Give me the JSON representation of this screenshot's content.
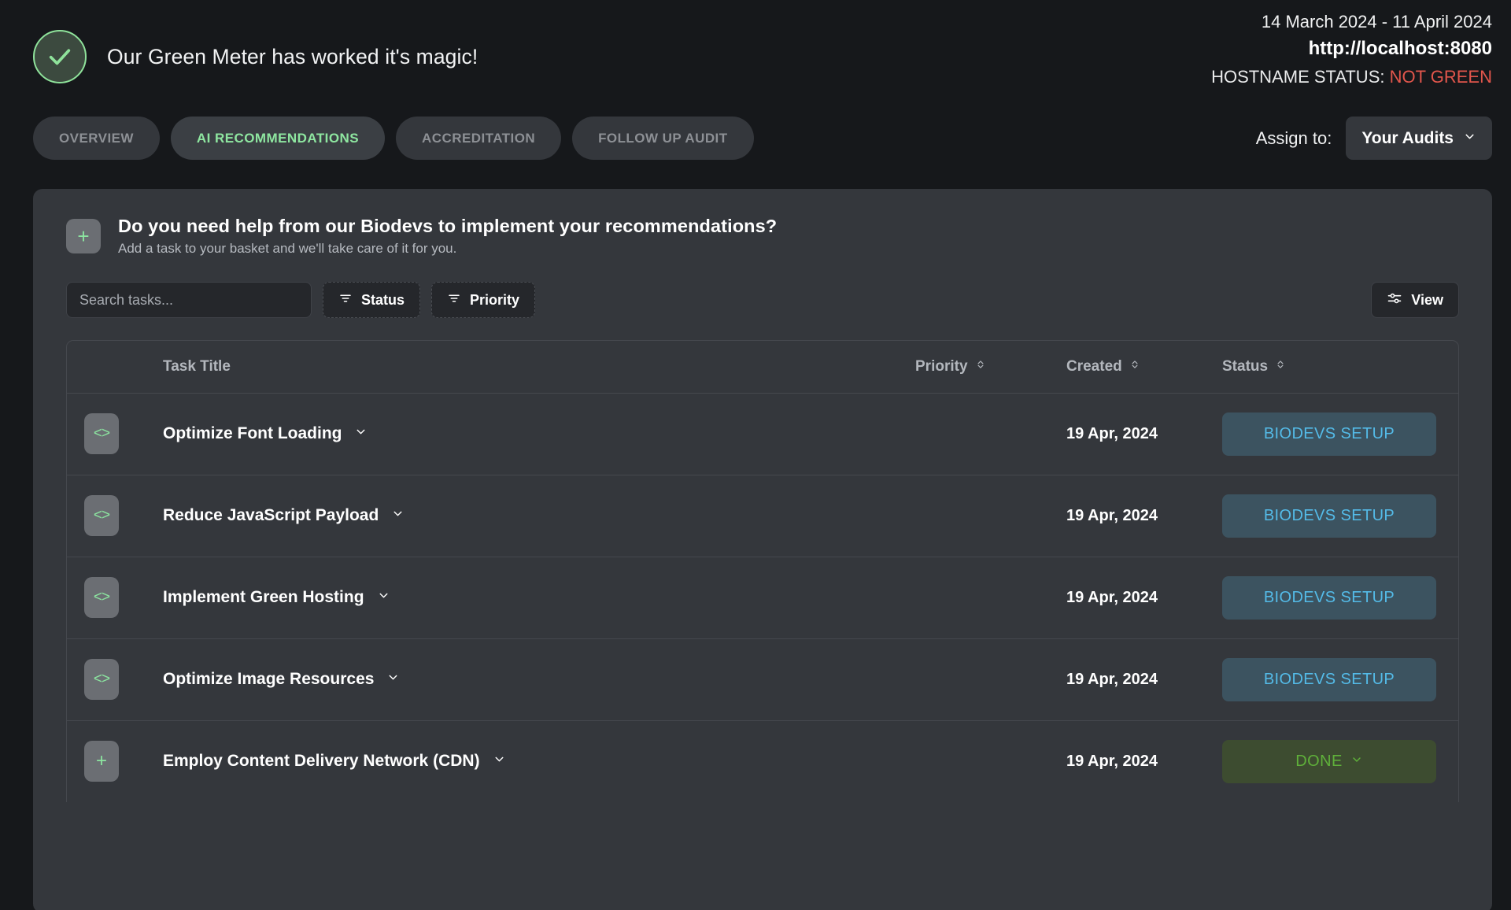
{
  "header": {
    "check_icon": "check-circle-icon",
    "headline": "Our Green Meter has worked it's magic!",
    "date_range": "14 March 2024 - 11 April 2024",
    "url": "http://localhost:8080",
    "hostname_status_label": "HOSTNAME STATUS:",
    "hostname_status_value": "NOT GREEN",
    "status_color": "#e2564c"
  },
  "tabs": [
    {
      "label": "OVERVIEW",
      "active": false
    },
    {
      "label": "AI RECOMMENDATIONS",
      "active": true
    },
    {
      "label": "ACCREDITATION",
      "active": false
    },
    {
      "label": "FOLLOW UP AUDIT",
      "active": false
    }
  ],
  "assign": {
    "label": "Assign to:",
    "selected": "Your Audits",
    "options": [
      "Your Audits"
    ]
  },
  "promo": {
    "badge_icon": "plus-icon",
    "title": "Do you need help from our Biodevs to implement your recommendations?",
    "subtitle": "Add a task to your basket and we'll take care of it for you."
  },
  "toolbar": {
    "search_placeholder": "Search tasks...",
    "search_value": "",
    "status_filter_label": "Status",
    "priority_filter_label": "Priority",
    "view_label": "View"
  },
  "table": {
    "columns": [
      {
        "key": "icon",
        "label": "",
        "sortable": false
      },
      {
        "key": "title",
        "label": "Task Title",
        "sortable": false
      },
      {
        "key": "priority",
        "label": "Priority",
        "sortable": true
      },
      {
        "key": "created",
        "label": "Created",
        "sortable": true
      },
      {
        "key": "status",
        "label": "Status",
        "sortable": true
      }
    ],
    "rows": [
      {
        "badge_icon": "code-icon",
        "title": "Optimize Font Loading",
        "priority": "",
        "created": "19 Apr, 2024",
        "status": "BIODEVS SETUP",
        "status_kind": "setup"
      },
      {
        "badge_icon": "code-icon",
        "title": "Reduce JavaScript Payload",
        "priority": "",
        "created": "19 Apr, 2024",
        "status": "BIODEVS SETUP",
        "status_kind": "setup"
      },
      {
        "badge_icon": "code-icon",
        "title": "Implement Green Hosting",
        "priority": "",
        "created": "19 Apr, 2024",
        "status": "BIODEVS SETUP",
        "status_kind": "setup"
      },
      {
        "badge_icon": "code-icon",
        "title": "Optimize Image Resources",
        "priority": "",
        "created": "19 Apr, 2024",
        "status": "BIODEVS SETUP",
        "status_kind": "setup"
      },
      {
        "badge_icon": "plus-icon",
        "title": "Employ Content Delivery Network (CDN)",
        "priority": "",
        "created": "19 Apr, 2024",
        "status": "DONE",
        "status_kind": "done"
      }
    ]
  },
  "colors": {
    "page_bg": "#16181b",
    "card_bg": "#34373c",
    "accent_green": "#8ee6a0",
    "status_red": "#e2564c",
    "setup_blue": "#54bbe8",
    "done_green": "#5fb03a"
  }
}
